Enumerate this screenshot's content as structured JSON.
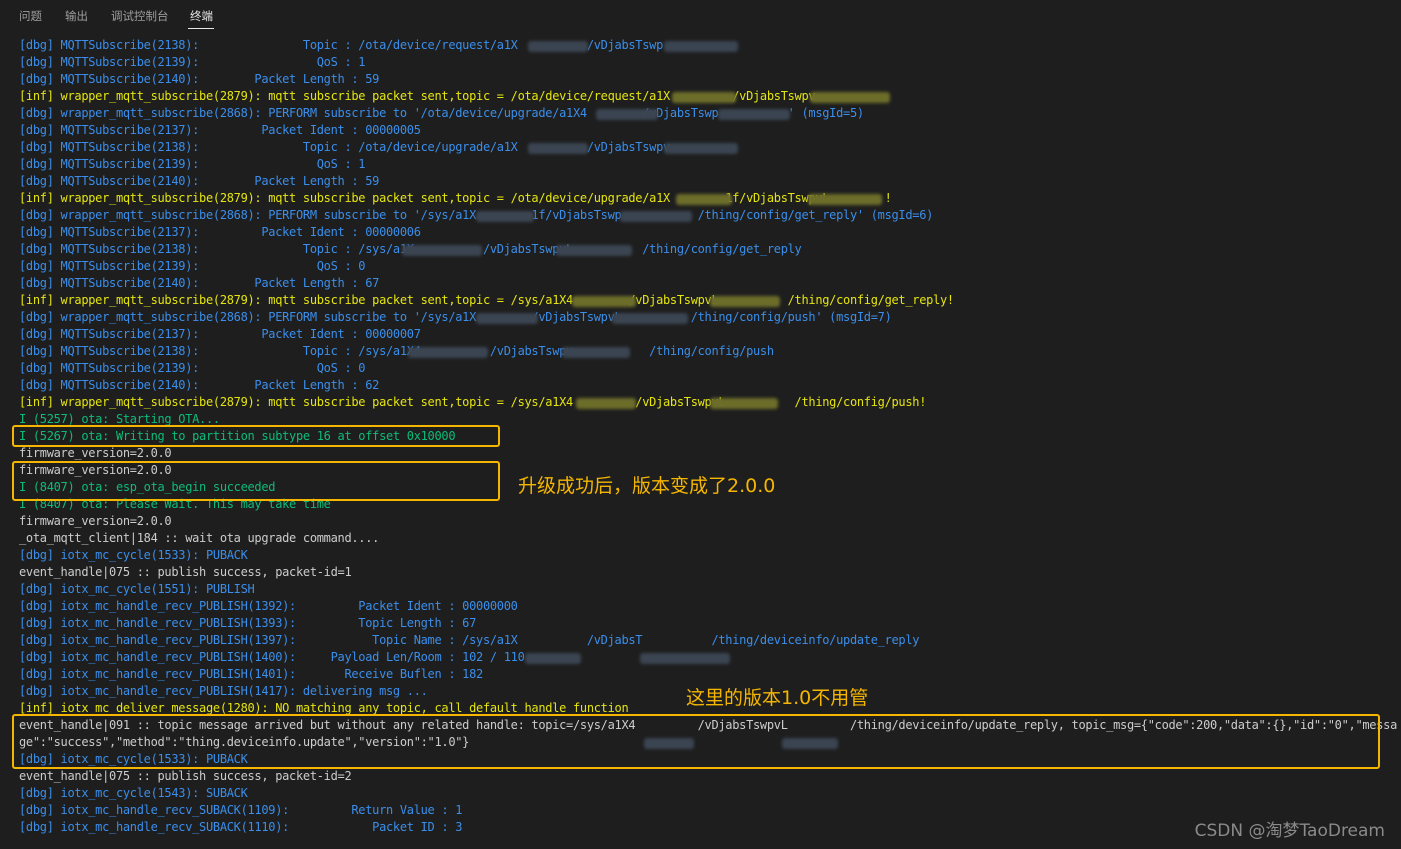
{
  "panel_tabs": [
    {
      "label": "问题",
      "active": false
    },
    {
      "label": "输出",
      "active": false
    },
    {
      "label": "调试控制台",
      "active": false
    },
    {
      "label": "终端",
      "active": true
    }
  ],
  "terminal_lines": [
    {
      "text": "[dbg] MQTTSubscribe(2138):               Topic : /ota/device/request/a1X          /vDjabsTswp",
      "color": "blue"
    },
    {
      "text": "[dbg] MQTTSubscribe(2139):                 QoS : 1",
      "color": "blue"
    },
    {
      "text": "[dbg] MQTTSubscribe(2140):        Packet Length : 59",
      "color": "blue"
    },
    {
      "text": "[inf] wrapper_mqtt_subscribe(2879): mqtt subscribe packet sent,topic = /ota/device/request/a1X         /vDjabsTswpv",
      "color": "yellow"
    },
    {
      "text": "[dbg] wrapper_mqtt_subscribe(2868): PERFORM subscribe to '/ota/device/upgrade/a1X4        /vDjabsTswp          ' (msgId=5)",
      "color": "blue"
    },
    {
      "text": "[dbg] MQTTSubscribe(2137):         Packet Ident : 00000005",
      "color": "blue"
    },
    {
      "text": "[dbg] MQTTSubscribe(2138):               Topic : /ota/device/upgrade/a1X          /vDjabsTswpv",
      "color": "blue"
    },
    {
      "text": "[dbg] MQTTSubscribe(2139):                 QoS : 1",
      "color": "blue"
    },
    {
      "text": "[dbg] MQTTSubscribe(2140):        Packet Length : 59",
      "color": "blue"
    },
    {
      "text": "[inf] wrapper_mqtt_subscribe(2879): mqtt subscribe packet sent,topic = /ota/device/upgrade/a1X        1f/vDjabsTswpvL        !",
      "color": "yellow"
    },
    {
      "text": "[dbg] wrapper_mqtt_subscribe(2868): PERFORM subscribe to '/sys/a1X        1f/vDjabsTswp           /thing/config/get_reply' (msgId=6)",
      "color": "blue"
    },
    {
      "text": "[dbg] MQTTSubscribe(2137):         Packet Ident : 00000006",
      "color": "blue"
    },
    {
      "text": "[dbg] MQTTSubscribe(2138):               Topic : /sys/a1X          /vDjabsTswpvL          /thing/config/get_reply",
      "color": "blue"
    },
    {
      "text": "[dbg] MQTTSubscribe(2139):                 QoS : 0",
      "color": "blue"
    },
    {
      "text": "[dbg] MQTTSubscribe(2140):        Packet Length : 67",
      "color": "blue"
    },
    {
      "text": "[inf] wrapper_mqtt_subscribe(2879): mqtt subscribe packet sent,topic = /sys/a1X4        /vDjabsTswpvL          /thing/config/get_reply!",
      "color": "yellow"
    },
    {
      "text": "[dbg] wrapper_mqtt_subscribe(2868): PERFORM subscribe to '/sys/a1X        /vDjabsTswpvL          /thing/config/push' (msgId=7)",
      "color": "blue"
    },
    {
      "text": "[dbg] MQTTSubscribe(2137):         Packet Ident : 00000007",
      "color": "blue"
    },
    {
      "text": "[dbg] MQTTSubscribe(2138):               Topic : /sys/a1X4          /vDjabsTswpv           /thing/config/push",
      "color": "blue"
    },
    {
      "text": "[dbg] MQTTSubscribe(2139):                 QoS : 0",
      "color": "blue"
    },
    {
      "text": "[dbg] MQTTSubscribe(2140):        Packet Length : 62",
      "color": "blue"
    },
    {
      "text": "[inf] wrapper_mqtt_subscribe(2879): mqtt subscribe packet sent,topic = /sys/a1X4         /vDjabsTswpvL          /thing/config/push!",
      "color": "yellow"
    },
    {
      "text": "I (5257) ota: Starting OTA...",
      "color": "green"
    },
    {
      "text": "I (5267) ota: Writing to partition subtype 16 at offset 0x10000",
      "color": "green"
    },
    {
      "text": "firmware_version=2.0.0",
      "color": "white"
    },
    {
      "text": "firmware_version=2.0.0",
      "color": "white"
    },
    {
      "text": "I (8407) ota: esp_ota_begin succeeded",
      "color": "green"
    },
    {
      "text": "I (8407) ota: Please Wait. This may take time",
      "color": "green"
    },
    {
      "text": "firmware_version=2.0.0",
      "color": "white"
    },
    {
      "text": "_ota_mqtt_client|184 :: wait ota upgrade command....",
      "color": "white"
    },
    {
      "text": "[dbg] iotx_mc_cycle(1533): PUBACK",
      "color": "blue"
    },
    {
      "text": "event_handle|075 :: publish success, packet-id=1",
      "color": "white"
    },
    {
      "text": "[dbg] iotx_mc_cycle(1551): PUBLISH",
      "color": "blue"
    },
    {
      "text": "[dbg] iotx_mc_handle_recv_PUBLISH(1392):         Packet Ident : 00000000",
      "color": "blue"
    },
    {
      "text": "[dbg] iotx_mc_handle_recv_PUBLISH(1393):         Topic Length : 67",
      "color": "blue"
    },
    {
      "text": "[dbg] iotx_mc_handle_recv_PUBLISH(1397):           Topic Name : /sys/a1X          /vDjabsT          /thing/deviceinfo/update_reply",
      "color": "blue"
    },
    {
      "text": "[dbg] iotx_mc_handle_recv_PUBLISH(1400):     Payload Len/Room : 102 / 110",
      "color": "blue"
    },
    {
      "text": "[dbg] iotx_mc_handle_recv_PUBLISH(1401):       Receive Buflen : 182",
      "color": "blue"
    },
    {
      "text": "[dbg] iotx_mc_handle_recv_PUBLISH(1417): delivering msg ...",
      "color": "blue"
    },
    {
      "text": "[inf] iotx_mc_deliver_message(1280): NO matching any topic, call default handle function",
      "color": "yellow"
    },
    {
      "text": "event_handle|091 :: topic message arrived but without any related handle: topic=/sys/a1X4         /vDjabsTswpvL         /thing/deviceinfo/update_reply, topic_msg={\"code\":200,\"data\":{},\"id\":\"0\",\"messa",
      "color": "white"
    },
    {
      "text": "ge\":\"success\",\"method\":\"thing.deviceinfo.update\",\"version\":\"1.0\"}",
      "color": "white"
    },
    {
      "text": "[dbg] iotx_mc_cycle(1533): PUBACK",
      "color": "blue"
    },
    {
      "text": "event_handle|075 :: publish success, packet-id=2",
      "color": "white"
    },
    {
      "text": "[dbg] iotx_mc_cycle(1543): SUBACK",
      "color": "blue"
    },
    {
      "text": "[dbg] iotx_mc_handle_recv_SUBACK(1109):         Return Value : 1",
      "color": "blue"
    },
    {
      "text": "[dbg] iotx_mc_handle_recv_SUBACK(1110):            Packet ID : 3",
      "color": "blue"
    }
  ],
  "annotations": {
    "version_note": "升级成功后，版本变成了2.0.0",
    "ignore_note": "这里的版本1.0不用管"
  },
  "watermark": "CSDN @淘梦TaoDream",
  "colors": {
    "background": "#1e1e1e",
    "blue": "#3b8eea",
    "yellow": "#e5e510",
    "green": "#0dbc79",
    "white": "#cccccc",
    "highlight_box": "#f5b600"
  }
}
